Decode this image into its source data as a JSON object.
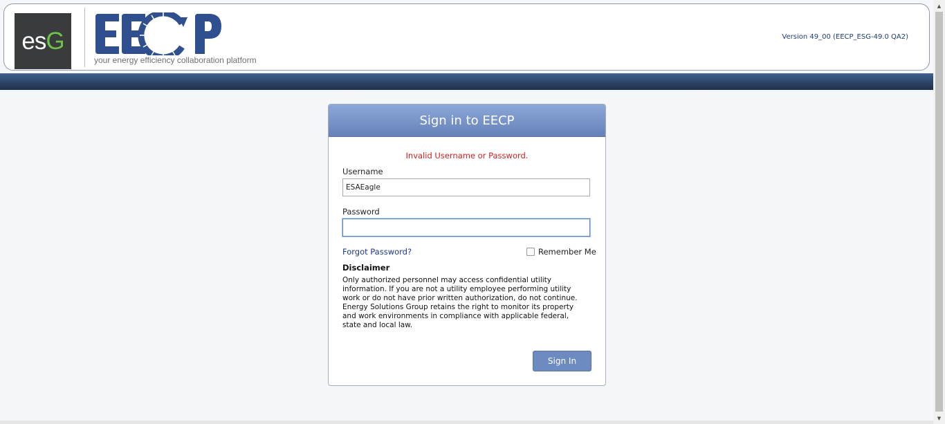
{
  "header": {
    "esg_logo": {
      "prefix": "es",
      "suffix": "G"
    },
    "eecp_logo": "EECP",
    "tagline": "your energy efficiency collaboration platform",
    "version": "Version 49_00 (EECP_ESG-49.0 QA2)"
  },
  "login": {
    "title": "Sign in to EECP",
    "error": "Invalid Username or Password.",
    "username_label": "Username",
    "username_value": "ESAEagle",
    "password_label": "Password",
    "password_value": "",
    "forgot_link": "Forgot Password?",
    "remember_label": "Remember Me",
    "remember_checked": false,
    "disclaimer_title": "Disclaimer",
    "disclaimer_lines": [
      "Only authorized personnel may access confidential utility",
      "information. If you are not a utility employee performing utility",
      "work or do not have prior written authorization, do not continue.",
      "Energy Solutions Group retains the right to monitor its property",
      "and work environments in compliance with applicable federal,",
      "state and local law."
    ],
    "signin_button": "Sign In"
  },
  "colors": {
    "accent_blue": "#2f4f8f",
    "header_band": "#2f4a70",
    "error_red": "#d01f1f",
    "button": "#6d8bc1",
    "esg_green": "#6dc24b"
  },
  "icons": {
    "scroll_up": "triangle-up-icon",
    "scroll_down": "triangle-down-icon"
  }
}
